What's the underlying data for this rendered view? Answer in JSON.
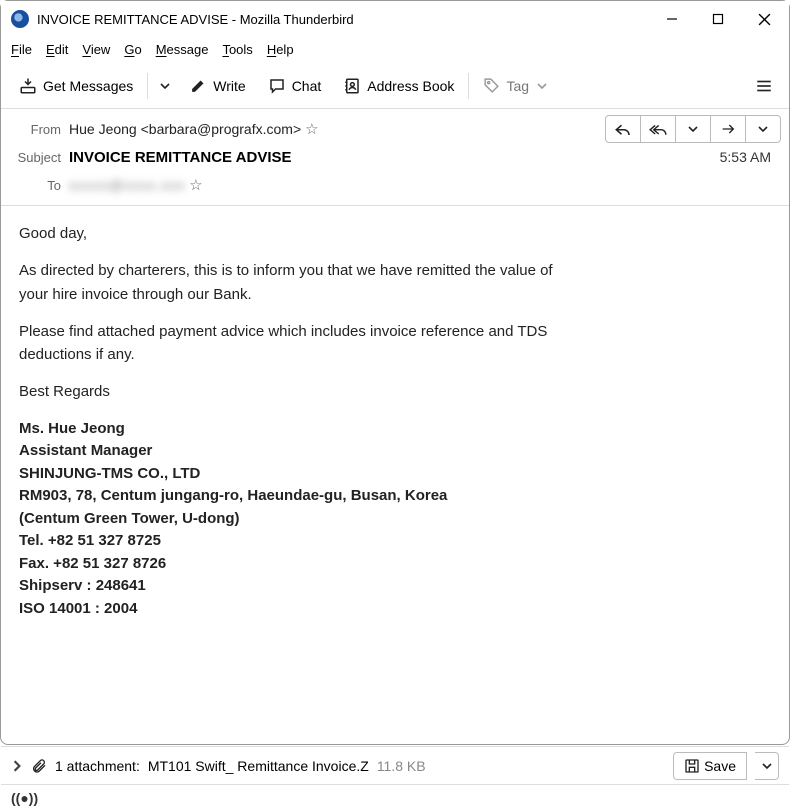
{
  "window": {
    "title": "INVOICE REMITTANCE ADVISE - Mozilla Thunderbird"
  },
  "menu": {
    "file": "File",
    "edit": "Edit",
    "view": "View",
    "go": "Go",
    "message": "Message",
    "tools": "Tools",
    "help": "Help"
  },
  "toolbar": {
    "get_messages": "Get Messages",
    "write": "Write",
    "chat": "Chat",
    "address_book": "Address Book",
    "tag": "Tag"
  },
  "headers": {
    "from_label": "From",
    "from_value": "Hue Jeong <barbara@prografx.com>",
    "subject_label": "Subject",
    "subject_value": "INVOICE REMITTANCE ADVISE",
    "to_label": "To",
    "to_value": "",
    "time": "5:53 AM"
  },
  "body": {
    "greeting": "Good day,",
    "p1": "As directed by charterers, this is to inform you that we have remitted the value of your hire invoice through our Bank.",
    "p2": "Please find attached payment advice which includes invoice reference and TDS deductions if any.",
    "regards": "Best  Regards",
    "sig_name": "Ms. Hue Jeong",
    "sig_title": "Assistant Manager",
    "sig_company": "SHINJUNG-TMS CO., LTD",
    "sig_addr1": "RM903, 78, Centum jungang-ro, Haeundae-gu, Busan, Korea",
    "sig_addr2": "(Centum Green Tower, U-dong)",
    "sig_tel": "Tel. +82 51 327 8725",
    "sig_fax": "Fax. +82 51 327 8726",
    "sig_ship": "Shipserv : 248641",
    "sig_iso": "ISO 14001 : 2004"
  },
  "attachment": {
    "count_text": "1 attachment:",
    "filename": "MT101 Swift_ Remittance Invoice.Z",
    "size": "11.8 KB",
    "save": "Save"
  }
}
